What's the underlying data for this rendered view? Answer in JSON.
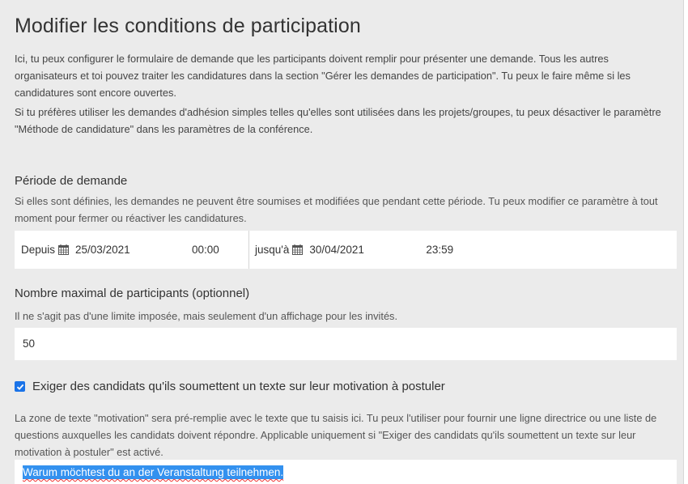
{
  "page": {
    "title": "Modifier les conditions de participation",
    "intro_1": "Ici, tu peux configurer le formulaire de demande que les participants doivent remplir pour présenter une demande. Tous les autres organisateurs et toi pouvez traiter les candidatures dans la section \"Gérer les demandes de participation\". Tu peux le faire même si les candidatures sont encore ouvertes.",
    "intro_2": "Si tu préfères utiliser les demandes d'adhésion simples telles qu'elles sont utilisées dans les projets/groupes, tu peux désactiver le paramètre \"Méthode de candidature\" dans les paramètres de la conférence."
  },
  "period": {
    "title": "Période de demande",
    "help": "Si elles sont définies, les demandes ne peuvent être soumises et modifiées que pendant cette période. Tu peux modifier ce paramètre à tout moment pour fermer ou réactiver les candidatures.",
    "from_label": "Depuis",
    "from_date": "25/03/2021",
    "from_time": "00:00",
    "to_label": "jusqu'à",
    "to_date": "30/04/2021",
    "to_time": "23:59"
  },
  "max_participants": {
    "title": "Nombre maximal de participants (optionnel)",
    "help": "Il ne s'agit pas d'une limite imposée, mais seulement d'un affichage pour les invités.",
    "value": "50"
  },
  "motivation": {
    "checkbox_label": "Exiger des candidats qu'ils soumettent un texte sur leur motivation à postuler",
    "checked": true,
    "help": "La zone de texte \"motivation\" sera pré-remplie avec le texte que tu saisis ici. Tu peux l'utiliser pour fournir une ligne directrice ou une liste de questions auxquelles les candidats doivent répondre. Applicable uniquement si \"Exiger des candidats qu'ils soumettent un texte sur leur motivation à postuler\" est activé.",
    "template_text": "Warum möchtest du an der Veranstaltung teilnehmen."
  },
  "colors": {
    "background": "#ebebeb",
    "accent": "#1a73e8",
    "selection": "#3391ef"
  },
  "icons": {
    "calendar": "calendar-icon",
    "check": "check-icon"
  }
}
